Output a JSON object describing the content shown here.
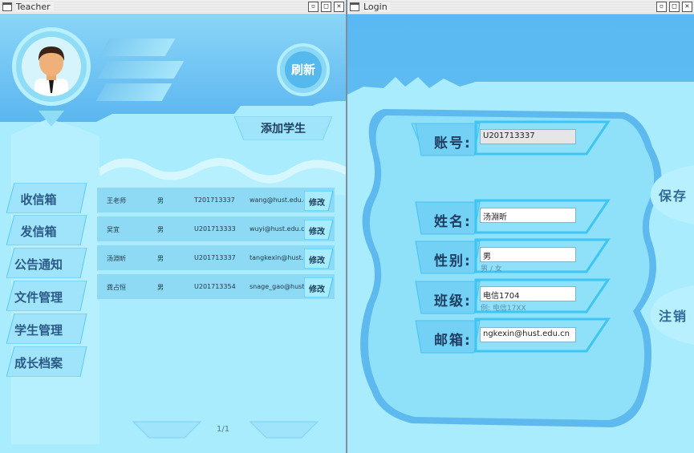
{
  "teacher_window": {
    "title": "Teacher",
    "title_buttons": [
      "minimize",
      "maximize",
      "close"
    ],
    "refresh_label": "刷新",
    "add_student_label": "添加学生",
    "nav": [
      {
        "label": "收信箱"
      },
      {
        "label": "发信箱"
      },
      {
        "label": "公告通知"
      },
      {
        "label": "文件管理"
      },
      {
        "label": "学生管理"
      },
      {
        "label": "成长档案"
      }
    ],
    "students": [
      {
        "name": "王老师",
        "gender": "男",
        "id": "T201713337",
        "email": "wang@hust.edu.cn",
        "action": "修改"
      },
      {
        "name": "吴宜",
        "gender": "男",
        "id": "U201713333",
        "email": "wuyi@hust.edu.cn",
        "action": "修改"
      },
      {
        "name": "汤淵昕",
        "gender": "男",
        "id": "U201713337",
        "email": "tangkexin@hust.edu.cn",
        "action": "修改"
      },
      {
        "name": "龚占恒",
        "gender": "男",
        "id": "U201713354",
        "email": "snage_gao@hust.edu...",
        "action": "修改"
      }
    ],
    "pager": "1/1"
  },
  "login_window": {
    "title": "Login",
    "title_buttons": [
      "minimize",
      "maximize",
      "close"
    ],
    "fields": {
      "account": {
        "label": "账号:",
        "value": "U201713337"
      },
      "name": {
        "label": "姓名:",
        "value": "汤淵昕"
      },
      "gender": {
        "label": "性别:",
        "value": "男",
        "hint": "男 / 女"
      },
      "class": {
        "label": "班级:",
        "value": "电信1704",
        "hint": "例: 电信17XX"
      },
      "email": {
        "label": "邮箱:",
        "value": "ngkexin@hust.edu.cn"
      }
    },
    "save_label": "保存",
    "logout_label": "注销"
  },
  "colors": {
    "window_bg": "#a8ecfd",
    "header_blue": "#5ab9f2",
    "panel_light": "#b6f0ff",
    "accent": "#3fc0f0",
    "row_bg": "#8ed9f3"
  }
}
